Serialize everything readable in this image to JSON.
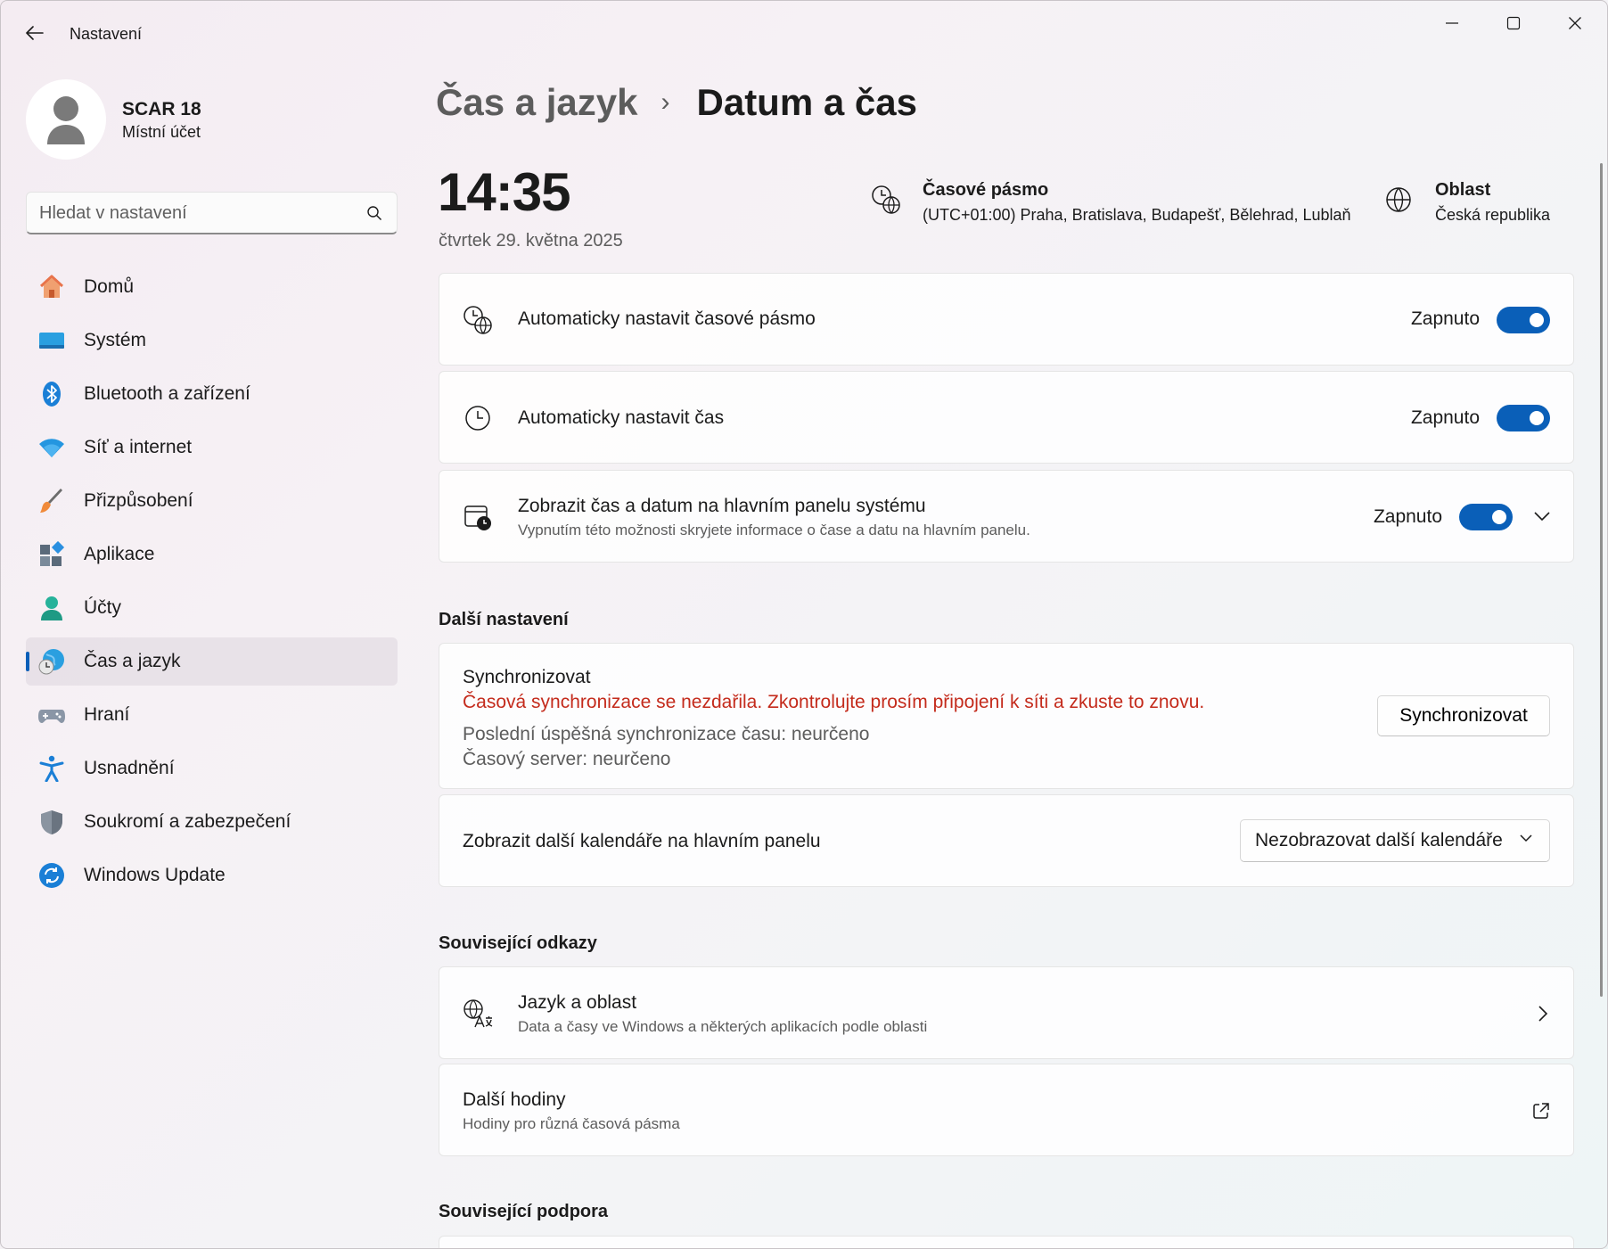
{
  "window": {
    "title": "Nastavení"
  },
  "user": {
    "name": "SCAR 18",
    "account_type": "Místní účet"
  },
  "search": {
    "placeholder": "Hledat v nastavení"
  },
  "sidebar": {
    "items": [
      {
        "label": "Domů",
        "icon": "home-icon"
      },
      {
        "label": "Systém",
        "icon": "system-icon"
      },
      {
        "label": "Bluetooth a zařízení",
        "icon": "bluetooth-icon"
      },
      {
        "label": "Síť a internet",
        "icon": "wifi-icon"
      },
      {
        "label": "Přizpůsobení",
        "icon": "brush-icon"
      },
      {
        "label": "Aplikace",
        "icon": "apps-icon"
      },
      {
        "label": "Účty",
        "icon": "accounts-icon"
      },
      {
        "label": "Čas a jazyk",
        "icon": "time-language-icon",
        "active": true
      },
      {
        "label": "Hraní",
        "icon": "gamepad-icon"
      },
      {
        "label": "Usnadnění",
        "icon": "accessibility-icon"
      },
      {
        "label": "Soukromí a zabezpečení",
        "icon": "shield-icon"
      },
      {
        "label": "Windows Update",
        "icon": "update-icon"
      }
    ]
  },
  "breadcrumb": {
    "parent": "Čas a jazyk",
    "separator": "›",
    "current": "Datum a čas"
  },
  "clock": {
    "time": "14:35",
    "date": "čtvrtek 29. května 2025"
  },
  "timezone": {
    "title": "Časové pásmo",
    "value": "(UTC+01:00) Praha, Bratislava, Budapešť, Bělehrad, Lublaň"
  },
  "region": {
    "title": "Oblast",
    "value": "Česká republika"
  },
  "settings": {
    "auto_timezone": {
      "label": "Automaticky nastavit časové pásmo",
      "state": "Zapnuto",
      "on": true
    },
    "auto_time": {
      "label": "Automaticky nastavit čas",
      "state": "Zapnuto",
      "on": true
    },
    "show_taskbar": {
      "label": "Zobrazit čas a datum na hlavním panelu systému",
      "description": "Vypnutím této možnosti skryjete informace o čase a datu na hlavním panelu.",
      "state": "Zapnuto",
      "on": true
    }
  },
  "additional": {
    "title": "Další nastavení",
    "sync": {
      "title": "Synchronizovat",
      "error": "Časová synchronizace se nezdařila. Zkontrolujte prosím připojení k síti a zkuste to znovu.",
      "last_sync": "Poslední úspěšná synchronizace času: neurčeno",
      "server": "Časový server: neurčeno",
      "button": "Synchronizovat"
    },
    "calendars": {
      "label": "Zobrazit další kalendáře na hlavním panelu",
      "selected": "Nezobrazovat další kalendáře"
    }
  },
  "related_links": {
    "title": "Související odkazy",
    "language": {
      "title": "Jazyk a oblast",
      "description": "Data a časy ve Windows a některých aplikacích podle oblasti"
    },
    "clocks": {
      "title": "Další hodiny",
      "description": "Hodiny pro různá časová pásma"
    }
  },
  "related_support": {
    "title": "Související podpora"
  },
  "colors": {
    "accent": "#0a5fb8",
    "error": "#c42b1c"
  }
}
